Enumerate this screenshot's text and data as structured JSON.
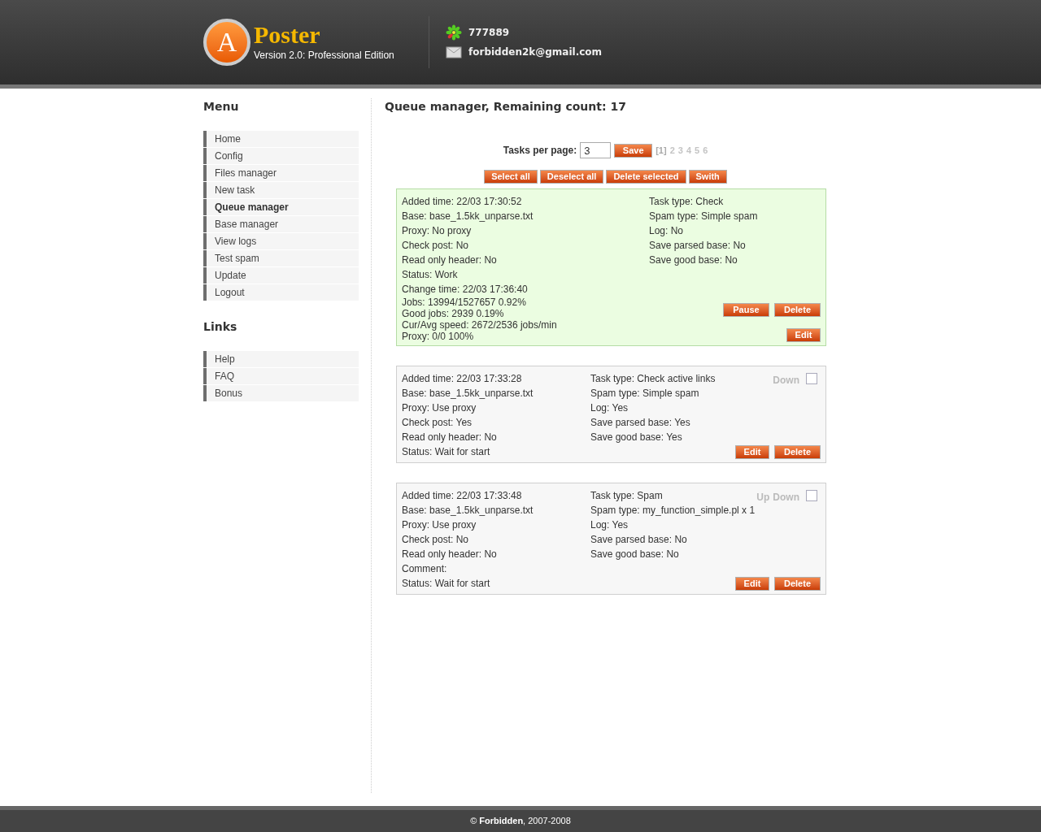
{
  "header": {
    "logo": {
      "letter": "A",
      "name": "Poster",
      "tagline": "Version 2.0: Professional Edition"
    },
    "contacts": [
      {
        "kind": "icq",
        "text": "777889"
      },
      {
        "kind": "email",
        "text": "forbidden2k@gmail.com"
      }
    ]
  },
  "sidebar": {
    "sections": [
      {
        "title": "Menu",
        "items": [
          {
            "label": "Home",
            "selected": false
          },
          {
            "label": "Config",
            "selected": false
          },
          {
            "label": "Files manager",
            "selected": false
          },
          {
            "label": "New task",
            "selected": false
          },
          {
            "label": "Queue manager",
            "selected": true
          },
          {
            "label": "Base manager",
            "selected": false
          },
          {
            "label": "View logs",
            "selected": false
          },
          {
            "label": "Test spam",
            "selected": false
          },
          {
            "label": "Update",
            "selected": false
          },
          {
            "label": "Logout",
            "selected": false
          }
        ]
      },
      {
        "title": "Links",
        "items": [
          {
            "label": "Help",
            "selected": false
          },
          {
            "label": "FAQ",
            "selected": false
          },
          {
            "label": "Bonus",
            "selected": false
          }
        ]
      }
    ]
  },
  "main": {
    "title": "Queue manager, Remaining count: 17",
    "tasks_per_page": {
      "label": "Tasks per page:",
      "value": "3",
      "button": "Save"
    },
    "pages": [
      {
        "label": "[1]",
        "selected": true
      },
      {
        "label": "2",
        "selected": false
      },
      {
        "label": "3",
        "selected": false
      },
      {
        "label": "4",
        "selected": false
      },
      {
        "label": "5",
        "selected": false
      },
      {
        "label": "6",
        "selected": false
      }
    ],
    "actions": [
      "Select all",
      "Deselect all",
      "Delete selected",
      "Swith"
    ],
    "tasks": [
      {
        "active": true,
        "left": [
          "Added time: 22/03 17:30:52",
          "Base: base_1.5kk_unparse.txt",
          "Proxy: No proxy",
          "Check post: No",
          "Read only header: No",
          "Status: Work",
          "Change time: 22/03 17:36:40"
        ],
        "stats": [
          "Jobs: 13994/1527657 0.92%",
          "Good jobs: 2939 0.19%",
          "Cur/Avg speed: 2672/2536 jobs/min",
          "Proxy: 0/0 100%"
        ],
        "right": [
          "Task type: Check",
          "Spam type: Simple spam",
          "Log: No",
          "Save parsed base: No",
          "Save good base: No"
        ],
        "button_rows": [
          [
            "Pause",
            "Delete"
          ],
          [
            "Edit"
          ]
        ]
      },
      {
        "active": false,
        "left": [
          "Added time: 22/03 17:33:28",
          "Base: base_1.5kk_unparse.txt",
          "Proxy: Use proxy",
          "Check post: Yes",
          "Read only header: No",
          "Status: Wait for start"
        ],
        "right": [
          "Task type: Check active links",
          "Spam type: Simple spam",
          "Log: Yes",
          "Save parsed base: Yes",
          "Save good base: Yes"
        ],
        "move_links": [
          "Down"
        ],
        "checked": false,
        "button_rows": [
          [
            "Edit",
            "Delete"
          ]
        ]
      },
      {
        "active": false,
        "left": [
          "Added time: 22/03 17:33:48",
          "Base: base_1.5kk_unparse.txt",
          "Proxy: Use proxy",
          "Check post: No",
          "Read only header: No",
          "Comment:",
          "Status: Wait for start"
        ],
        "right": [
          "Task type: Spam",
          "Spam type: my_function_simple.pl x 1",
          "Log: Yes",
          "Save parsed base: No",
          "Save good base: No"
        ],
        "move_links": [
          "Up",
          "Down"
        ],
        "checked": false,
        "button_rows": [
          [
            "Edit",
            "Delete"
          ]
        ]
      }
    ]
  },
  "footer": "© **Forbidden**, 2007-2008"
}
